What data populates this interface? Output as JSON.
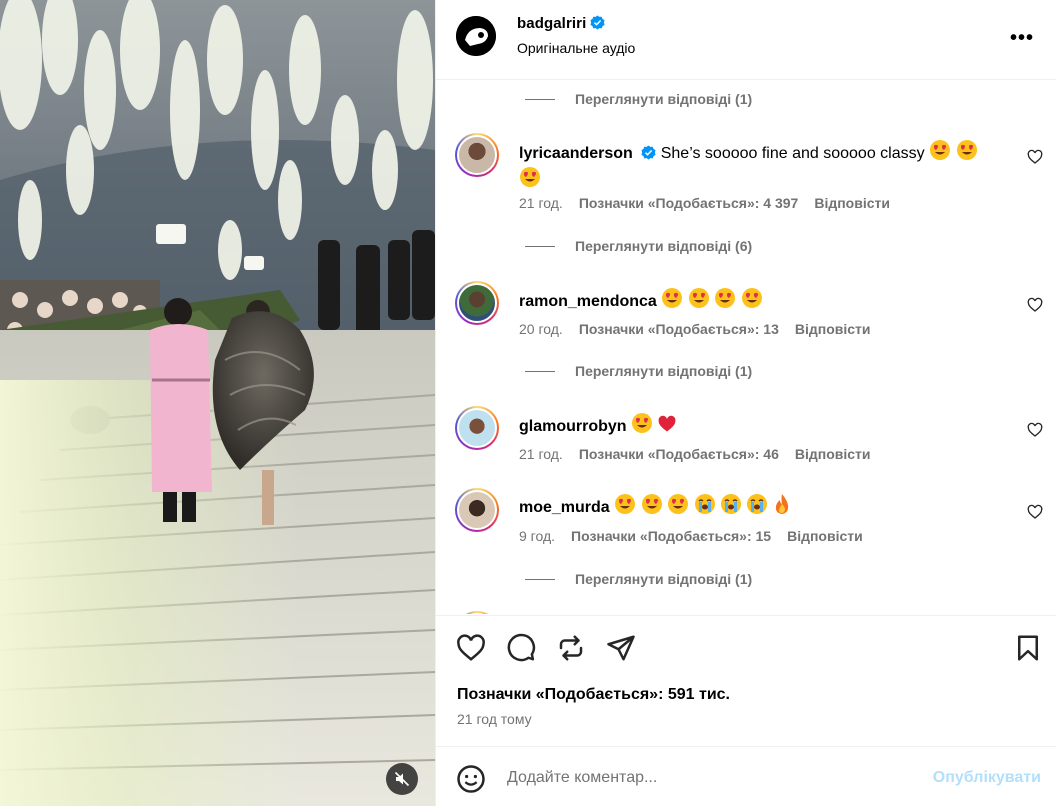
{
  "post": {
    "username": "badgalriri",
    "audio": "Оригінальне аудіо",
    "more_label": "•••"
  },
  "comments": [
    {
      "username": "lyricaanderson",
      "verified": true,
      "text": "She’s sooooo fine and sooooo classy",
      "emojis": [
        "heart-eyes",
        "heart-eyes",
        "heart-eyes"
      ],
      "age": "21 год.",
      "likes": "Позначки «Подобається»: 4 397",
      "reply": "Відповісти",
      "view_replies": "Переглянути відповіді (6)"
    },
    {
      "username": "ramon_mendonca",
      "verified": false,
      "text": "",
      "emojis": [
        "heart-eyes",
        "heart-eyes",
        "heart-eyes",
        "heart-eyes"
      ],
      "age": "20 год.",
      "likes": "Позначки «Подобається»: 13",
      "reply": "Відповісти",
      "view_replies": "Переглянути відповіді (1)"
    },
    {
      "username": "glamourrobyn",
      "verified": false,
      "text": "",
      "emojis": [
        "heart-eyes",
        "red-heart"
      ],
      "age": "21 год.",
      "likes": "Позначки «Подобається»: 46",
      "reply": "Відповісти",
      "view_replies": ""
    },
    {
      "username": "moe_murda",
      "verified": false,
      "text": "",
      "emojis": [
        "heart-eyes",
        "heart-eyes",
        "heart-eyes",
        "crying",
        "crying",
        "crying",
        "fire"
      ],
      "age": "9 год.",
      "likes": "Позначки «Подобається»: 15",
      "reply": "Відповісти",
      "view_replies": "Переглянути відповіді (1)"
    }
  ],
  "top_view_replies": "Переглянути відповіді (1)",
  "footer": {
    "likes": "Позначки «Подобається»: 591 тис.",
    "time": "21 год тому",
    "placeholder": "Додайте коментар...",
    "publish": "Опублікувати"
  },
  "colors": {
    "muted": "#737373",
    "border": "#efefef",
    "publish": "#b2dffc",
    "verified": "#0095f6"
  }
}
